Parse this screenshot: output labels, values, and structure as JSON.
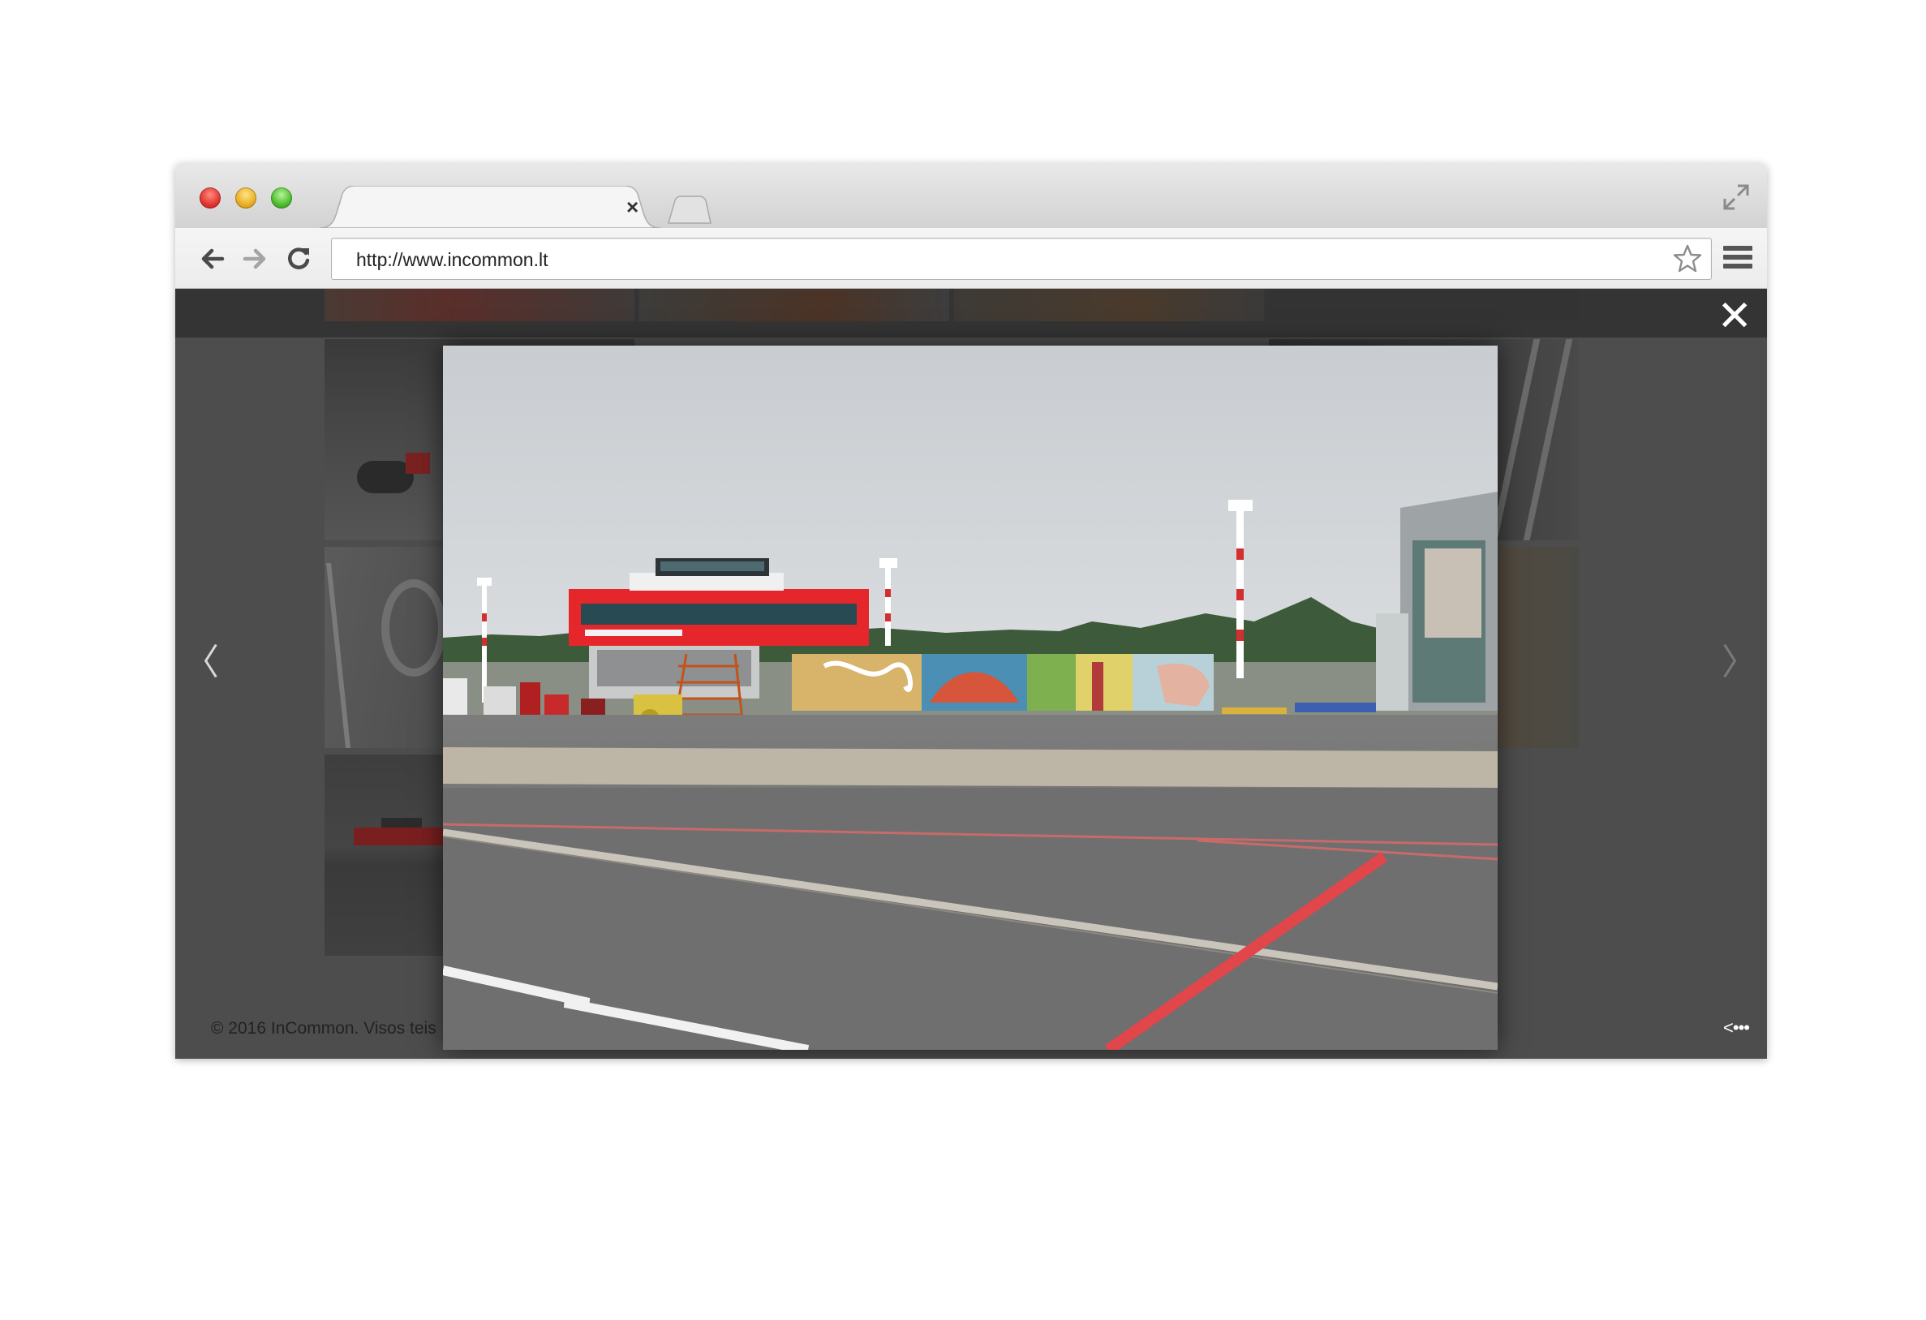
{
  "browser": {
    "tab": {
      "title": "",
      "close_glyph": "×"
    },
    "address_bar": {
      "url": "http://www.incommon.lt"
    },
    "icons": [
      "close-light",
      "minimize-light",
      "zoom-light",
      "back-arrow-icon",
      "forward-arrow-icon",
      "reload-icon",
      "star-icon",
      "menu-icon",
      "fullscreen-icon"
    ]
  },
  "lightbox": {
    "close_glyph": "✕",
    "prev_glyph": "〈",
    "next_glyph": "〉",
    "photo_subject": "airport apron with red control tower and graffiti wall"
  },
  "footer": {
    "copyright": "© 2016 InCommon. Visos teis",
    "more_glyph": "<•••"
  },
  "colors": {
    "page_bg": "#4d4d4d",
    "top_strip": "#343434",
    "tower_red": "#e5262a"
  }
}
